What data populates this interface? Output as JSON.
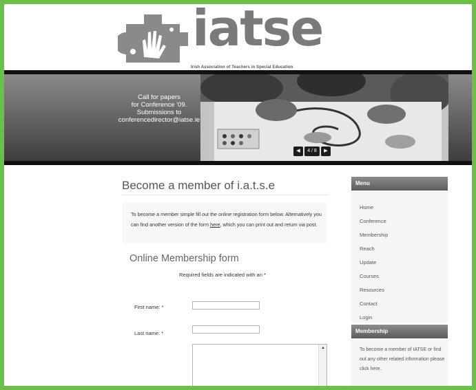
{
  "header": {
    "logo_text": "iatse",
    "logo_subtitle": "Irish Association of Teachers in Special Education"
  },
  "banner": {
    "text_lines": [
      "Call for papers",
      "for Conference '09.",
      "Submissions to",
      "conferencedirector@iatse.ie"
    ],
    "slider": {
      "prev": "◀",
      "counter": "4 / 8",
      "next": "▶"
    }
  },
  "main": {
    "title": "Become a member of i.a.t.s.e",
    "intro_before_link": "To become a member simple fill out the online registration form below. Alternatively you can find another version of the form ",
    "intro_link": "here",
    "intro_after_link": ", which you can print out and return via post.",
    "form_title": "Online Membership form",
    "required_note": "Required fields are indicated with an *",
    "fields": [
      {
        "label": "First name: *",
        "value": "",
        "placeholder": ""
      },
      {
        "label": "Last name: *",
        "value": "",
        "placeholder": ""
      }
    ]
  },
  "sidebar": {
    "menu_title": "Menu",
    "menu_items": [
      "Home",
      "Conference",
      "Membership",
      "Reach",
      "Update",
      "Courses",
      "Resources",
      "Contact",
      "Login"
    ],
    "membership_title": "Membership",
    "membership_text": "To become a member of IATSE or find out any other related information please click here."
  },
  "colors": {
    "page_border": "#6cc04a",
    "logo_gray": "#7a7a7a",
    "banner_dark": "#111111"
  },
  "icons": {
    "logo": "hand-logo-icon",
    "prev": "prev-arrow-icon",
    "next": "next-arrow-icon",
    "textarea_scroll": "scroll-up-icon"
  }
}
